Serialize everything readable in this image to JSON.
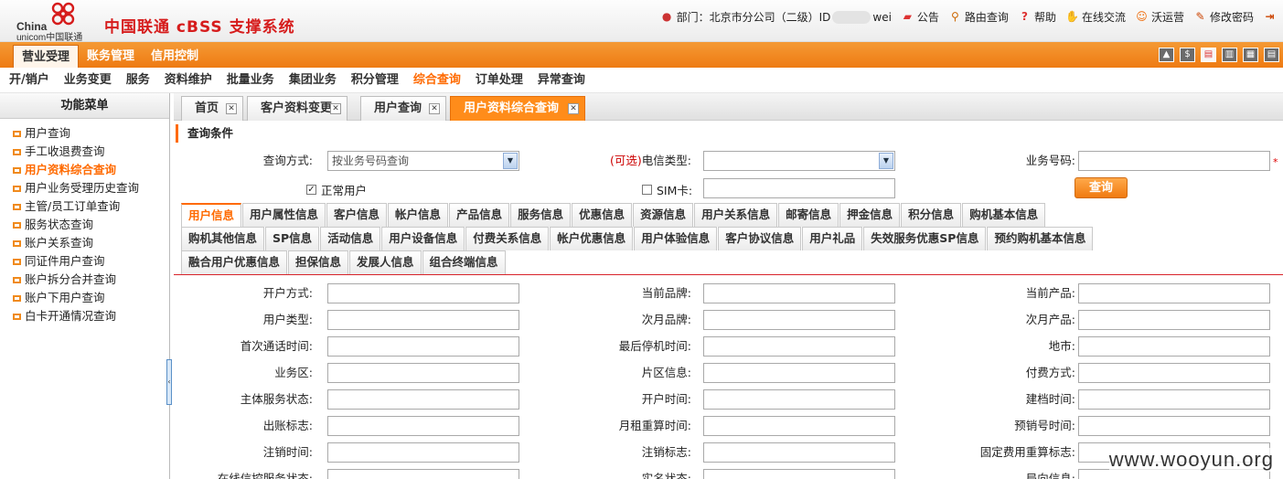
{
  "header": {
    "logo_en_1": "China",
    "logo_en_2": "unicom中国联通",
    "app_title": "中国联通 cBSS 支撑系统",
    "dept_label": "部门：北京市分公司（二级）ID",
    "dept_suffix": "wei",
    "links": [
      "公告",
      "路由查询",
      "帮助",
      "在线交流",
      "沃运营",
      "修改密码"
    ]
  },
  "orange_nav": {
    "tabs": [
      "营业受理",
      "账务管理",
      "信用控制"
    ],
    "active": 0
  },
  "sub_nav": {
    "items": [
      "开/销户",
      "业务变更",
      "服务",
      "资料维护",
      "批量业务",
      "集团业务",
      "积分管理",
      "综合查询",
      "订单处理",
      "异常查询"
    ],
    "active": 7
  },
  "sidebar": {
    "title": "功能菜单",
    "items": [
      "用户查询",
      "手工收退费查询",
      "用户资料综合查询",
      "用户业务受理历史查询",
      "主管/员工订单查询",
      "服务状态查询",
      "账户关系查询",
      "同证件用户查询",
      "账户拆分合并查询",
      "账户下用户查询",
      "白卡开通情况查询"
    ],
    "active": 2
  },
  "page_tabs": [
    "首页",
    "客户资料变更",
    "用户查询",
    "用户资料综合查询"
  ],
  "query": {
    "section_title": "查询条件",
    "method_label": "查询方式:",
    "method_value": "按业务号码查询",
    "optional": "(可选)",
    "telecom_type_label": "电信类型:",
    "service_no_label": "业务号码:",
    "required_mark": "*",
    "normal_user_label": "正常用户",
    "sim_label": "SIM卡:",
    "query_button": "查询"
  },
  "info_tabs": {
    "row1": [
      "用户信息",
      "用户属性信息",
      "客户信息",
      "帐户信息",
      "产品信息",
      "服务信息",
      "优惠信息",
      "资源信息",
      "用户关系信息",
      "邮寄信息",
      "押金信息",
      "积分信息",
      "购机基本信息"
    ],
    "row2": [
      "购机其他信息",
      "SP信息",
      "活动信息",
      "用户设备信息",
      "付费关系信息",
      "帐户优惠信息",
      "用户体验信息",
      "客户协议信息",
      "用户礼品",
      "失效服务优惠SP信息",
      "预约购机基本信息"
    ],
    "row3": [
      "融合用户优惠信息",
      "担保信息",
      "发展人信息",
      "组合终端信息"
    ]
  },
  "fields": [
    [
      "开户方式:",
      "当前品牌:",
      "当前产品:"
    ],
    [
      "用户类型:",
      "次月品牌:",
      "次月产品:"
    ],
    [
      "首次通话时间:",
      "最后停机时间:",
      "地市:"
    ],
    [
      "业务区:",
      "片区信息:",
      "付费方式:"
    ],
    [
      "主体服务状态:",
      "开户时间:",
      "建档时间:"
    ],
    [
      "出账标志:",
      "月租重算时间:",
      "预销号时间:"
    ],
    [
      "注销时间:",
      "注销标志:",
      "固定费用重算标志:"
    ],
    [
      "在线信控服务状态:",
      "实名状态:",
      "局向信息:"
    ]
  ],
  "watermark": "www.wooyun.org",
  "colors": {
    "accent": "#ff6a00",
    "nav": "#ee7a12",
    "title_red": "#d61c1c"
  }
}
